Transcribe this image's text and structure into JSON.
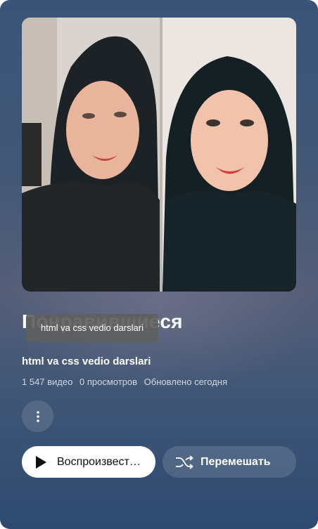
{
  "playlist": {
    "title": "Понравившиеся",
    "tooltip": "html va css vedio darslari",
    "owner": "html va css vedio darslari",
    "video_count": "1 547 видео",
    "views": "0 просмотров",
    "updated": "Обновлено сегодня"
  },
  "actions": {
    "play_label": "Воспроизвести все",
    "shuffle_label": "Перемешать",
    "more_icon": "more-vertical-icon",
    "play_icon": "play-icon",
    "shuffle_icon": "shuffle-icon"
  },
  "colors": {
    "panel_top": "#3a5478",
    "panel_bottom": "#2e4a70",
    "play_button_bg": "#ffffff",
    "text_primary": "#ffffff"
  }
}
